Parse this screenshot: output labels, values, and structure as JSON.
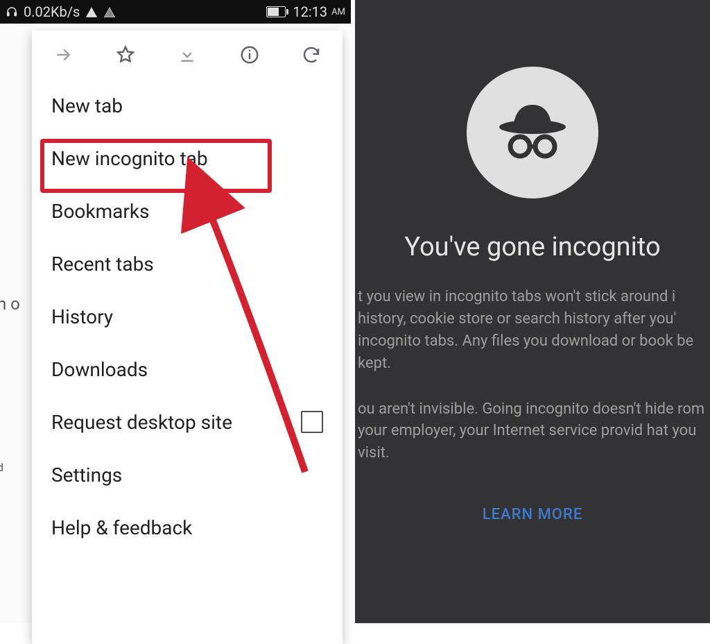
{
  "statusbar": {
    "speed": "0.02Kb/s",
    "time": "12:13",
    "time_suffix": "AM"
  },
  "background": {
    "search_fragment": "h o",
    "card_char": "d"
  },
  "menu": {
    "items": [
      "New tab",
      "New incognito tab",
      "Bookmarks",
      "Recent tabs",
      "History",
      "Downloads",
      "Request desktop site",
      "Settings",
      "Help & feedback"
    ]
  },
  "incognito": {
    "title": "You've gone incognito",
    "para1": "t you view in incognito tabs won't stick around i history, cookie store or search history after you' incognito tabs. Any files you download or book be kept.",
    "para2": "ou aren't invisible. Going incognito doesn't hide rom your employer, your Internet service provid hat you visit.",
    "learn": "LEARN MORE"
  }
}
